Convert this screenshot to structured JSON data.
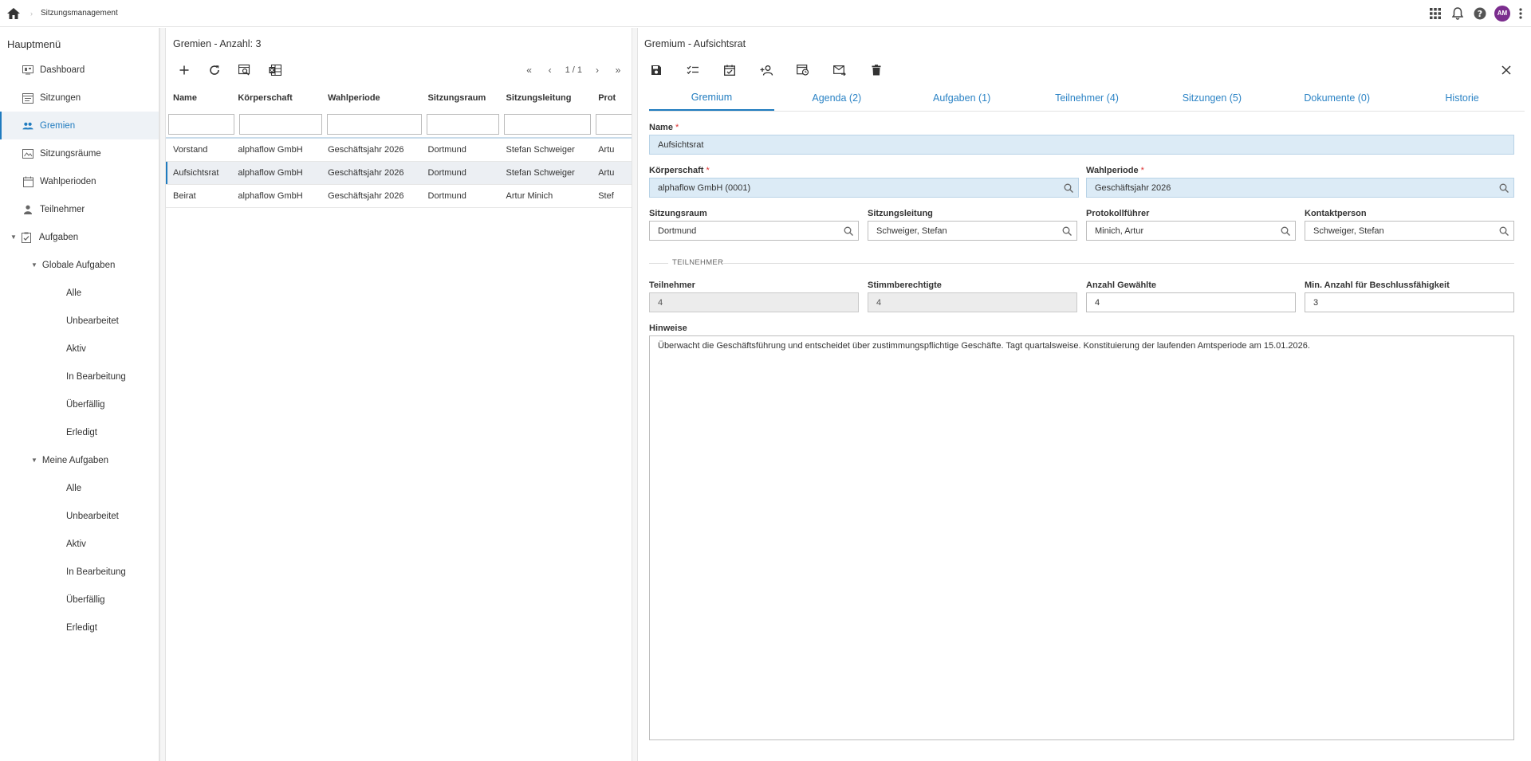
{
  "topbar": {
    "breadcrumb": "Sitzungsmanagement",
    "avatar_initials": "AM"
  },
  "sidebar": {
    "title": "Hauptmenü",
    "items": [
      {
        "label": "Dashboard",
        "icon": "dashboard-icon"
      },
      {
        "label": "Sitzungen",
        "icon": "calendar-list-icon"
      },
      {
        "label": "Gremien",
        "icon": "group-icon",
        "active": true
      },
      {
        "label": "Sitzungsräume",
        "icon": "room-icon"
      },
      {
        "label": "Wahlperioden",
        "icon": "calendar-icon"
      },
      {
        "label": "Teilnehmer",
        "icon": "person-icon"
      }
    ],
    "aufgaben": {
      "label": "Aufgaben",
      "global": {
        "label": "Globale Aufgaben",
        "items": [
          "Alle",
          "Unbearbeitet",
          "Aktiv",
          "In Bearbeitung",
          "Überfällig",
          "Erledigt"
        ]
      },
      "mine": {
        "label": "Meine Aufgaben",
        "items": [
          "Alle",
          "Unbearbeitet",
          "Aktiv",
          "In Bearbeitung",
          "Überfällig",
          "Erledigt"
        ]
      }
    }
  },
  "list": {
    "title": "Gremien - Anzahl: 3",
    "pager": "1 / 1",
    "columns": [
      "Name",
      "Körperschaft",
      "Wahlperiode",
      "Sitzungsraum",
      "Sitzungsleitung",
      "Prot"
    ],
    "rows": [
      [
        "Vorstand",
        "alphaflow GmbH",
        "Geschäftsjahr 2026",
        "Dortmund",
        "Stefan Schweiger",
        "Artu"
      ],
      [
        "Aufsichtsrat",
        "alphaflow GmbH",
        "Geschäftsjahr 2026",
        "Dortmund",
        "Stefan Schweiger",
        "Artu"
      ],
      [
        "Beirat",
        "alphaflow GmbH",
        "Geschäftsjahr 2026",
        "Dortmund",
        "Artur Minich",
        "Stef"
      ]
    ],
    "selected_row": 1
  },
  "detail": {
    "title": "Gremium - Aufsichtsrat",
    "tabs": [
      "Gremium",
      "Agenda (2)",
      "Aufgaben (1)",
      "Teilnehmer (4)",
      "Sitzungen (5)",
      "Dokumente (0)",
      "Historie"
    ],
    "form": {
      "name_label": "Name",
      "name_value": "Aufsichtsrat",
      "koerperschaft_label": "Körperschaft",
      "koerperschaft_value": "alphaflow GmbH (0001)",
      "wahlperiode_label": "Wahlperiode",
      "wahlperiode_value": "Geschäftsjahr 2026",
      "sitzungsraum_label": "Sitzungsraum",
      "sitzungsraum_value": "Dortmund",
      "sitzungsleitung_label": "Sitzungsleitung",
      "sitzungsleitung_value": "Schweiger, Stefan",
      "protokollfuehrer_label": "Protokollführer",
      "protokollfuehrer_value": "Minich, Artur",
      "kontaktperson_label": "Kontaktperson",
      "kontaktperson_value": "Schweiger, Stefan",
      "section_label": "TEILNEHMER",
      "teilnehmer_label": "Teilnehmer",
      "teilnehmer_value": "4",
      "stimmberechtigte_label": "Stimmberechtigte",
      "stimmberechtigte_value": "4",
      "gewaehlte_label": "Anzahl Gewählte",
      "gewaehlte_value": "4",
      "min_label": "Min. Anzahl für Beschlussfähigkeit",
      "min_value": "3",
      "hinweise_label": "Hinweise",
      "hinweise_value": "Überwacht die Geschäftsführung und entscheidet über zustimmungspflichtige Geschäfte. Tagt quartalsweise. Konstituierung der laufenden Amtsperiode am 15.01.2026."
    }
  },
  "colors": {
    "accent": "#1f7bbf",
    "tab_text": "#2b83c5",
    "field_blue": "#dcebf6",
    "field_grey": "#ececec",
    "avatar": "#7b2d8e",
    "required": "#dd3333"
  }
}
